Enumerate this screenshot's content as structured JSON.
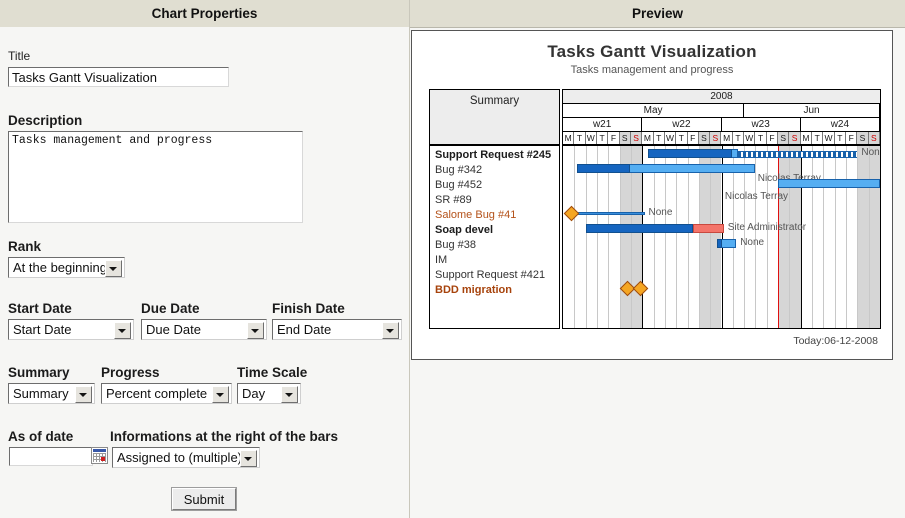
{
  "panels": {
    "left_title": "Chart Properties",
    "right_title": "Preview"
  },
  "form": {
    "title_label": "Title",
    "title_value": "Tasks Gantt Visualization",
    "description_label": "Description",
    "description_value": "Tasks management and progress",
    "rank_label": "Rank",
    "rank_value": "At the beginning",
    "start_date_label": "Start Date",
    "start_date_value": "Start Date",
    "due_date_label": "Due Date",
    "due_date_value": "Due Date",
    "finish_date_label": "Finish Date",
    "finish_date_value": "End Date",
    "summary_label": "Summary",
    "summary_value": "Summary",
    "progress_label": "Progress",
    "progress_value": "Percent complete",
    "time_scale_label": "Time Scale",
    "time_scale_value": "Day",
    "as_of_date_label": "As of date",
    "as_of_date_value": "",
    "info_right_label": "Informations at the right of the bars",
    "info_right_value": "Assigned to (multiple)",
    "submit_label": "Submit",
    "calendar_icon": "calendar-icon"
  },
  "chart_data": {
    "type": "gantt",
    "title": "Tasks Gantt Visualization",
    "subtitle": "Tasks management and progress",
    "summary_header": "Summary",
    "year": "2008",
    "months": [
      {
        "label": "May",
        "days": 16
      },
      {
        "label": "Jun",
        "days": 12
      }
    ],
    "weeks": [
      {
        "label": "w21",
        "days": 7
      },
      {
        "label": "w22",
        "days": 7
      },
      {
        "label": "w23",
        "days": 7
      },
      {
        "label": "w24",
        "days": 7
      }
    ],
    "day_letters": [
      "M",
      "T",
      "W",
      "T",
      "F",
      "S",
      "S",
      "M",
      "T",
      "W",
      "T",
      "F",
      "S",
      "S",
      "M",
      "T",
      "W",
      "T",
      "F",
      "S",
      "S",
      "M",
      "T",
      "W",
      "T",
      "F",
      "S",
      "S"
    ],
    "weekend_indices": [
      5,
      6,
      12,
      13,
      19,
      20,
      26,
      27
    ],
    "sunday_indices": [
      6,
      13,
      20,
      27
    ],
    "today_label": "Today:06-12-2008",
    "today_index": 19.0,
    "tasks": [
      {
        "name": "Support Request #245",
        "style": "bold",
        "bar": {
          "start": 7.5,
          "end": 15.5,
          "progress": 0.93
        },
        "dotted": {
          "start": 15.5,
          "end": 26.0
        },
        "label": "None"
      },
      {
        "name": "Bug #342",
        "style": "normal",
        "bar": {
          "start": 1.2,
          "end": 17.0,
          "progress": 0.3
        },
        "label": "Nicolas Terray"
      },
      {
        "name": "Bug #452",
        "style": "normal",
        "bar": {
          "start": 19.0,
          "end": 28.0,
          "progress": 0.0
        },
        "label": ""
      },
      {
        "name": "SR #89",
        "style": "normal",
        "label": "Nicolas Terray"
      },
      {
        "name": "Salome Bug #41",
        "style": "orange",
        "milestone": 0.4,
        "thinline": {
          "start": 0.8,
          "end": 7.2
        },
        "label": "None"
      },
      {
        "name": "Soap devel",
        "style": "bold",
        "bar": {
          "start": 2.0,
          "end": 14.2,
          "progress": 0.78
        },
        "late": {
          "start": 11.5,
          "end": 14.2
        },
        "label": "Site Administrator"
      },
      {
        "name": "Bug #38",
        "style": "normal",
        "smallbar": {
          "start": 13.6,
          "end": 15.3,
          "progress": 0.25
        },
        "label": "None"
      },
      {
        "name": "IM",
        "style": "normal",
        "label": ""
      },
      {
        "name": "Support Request #421",
        "style": "normal",
        "label": ""
      },
      {
        "name": "BDD migration",
        "style": "boldorange",
        "milestones": [
          5.4,
          6.5
        ],
        "label": ""
      }
    ],
    "bar_color": "#55aef2",
    "progress_color": "#1565c0",
    "late_color": "#f4746a",
    "milestone_color": "#f5a623",
    "today_color": "#e01010"
  }
}
